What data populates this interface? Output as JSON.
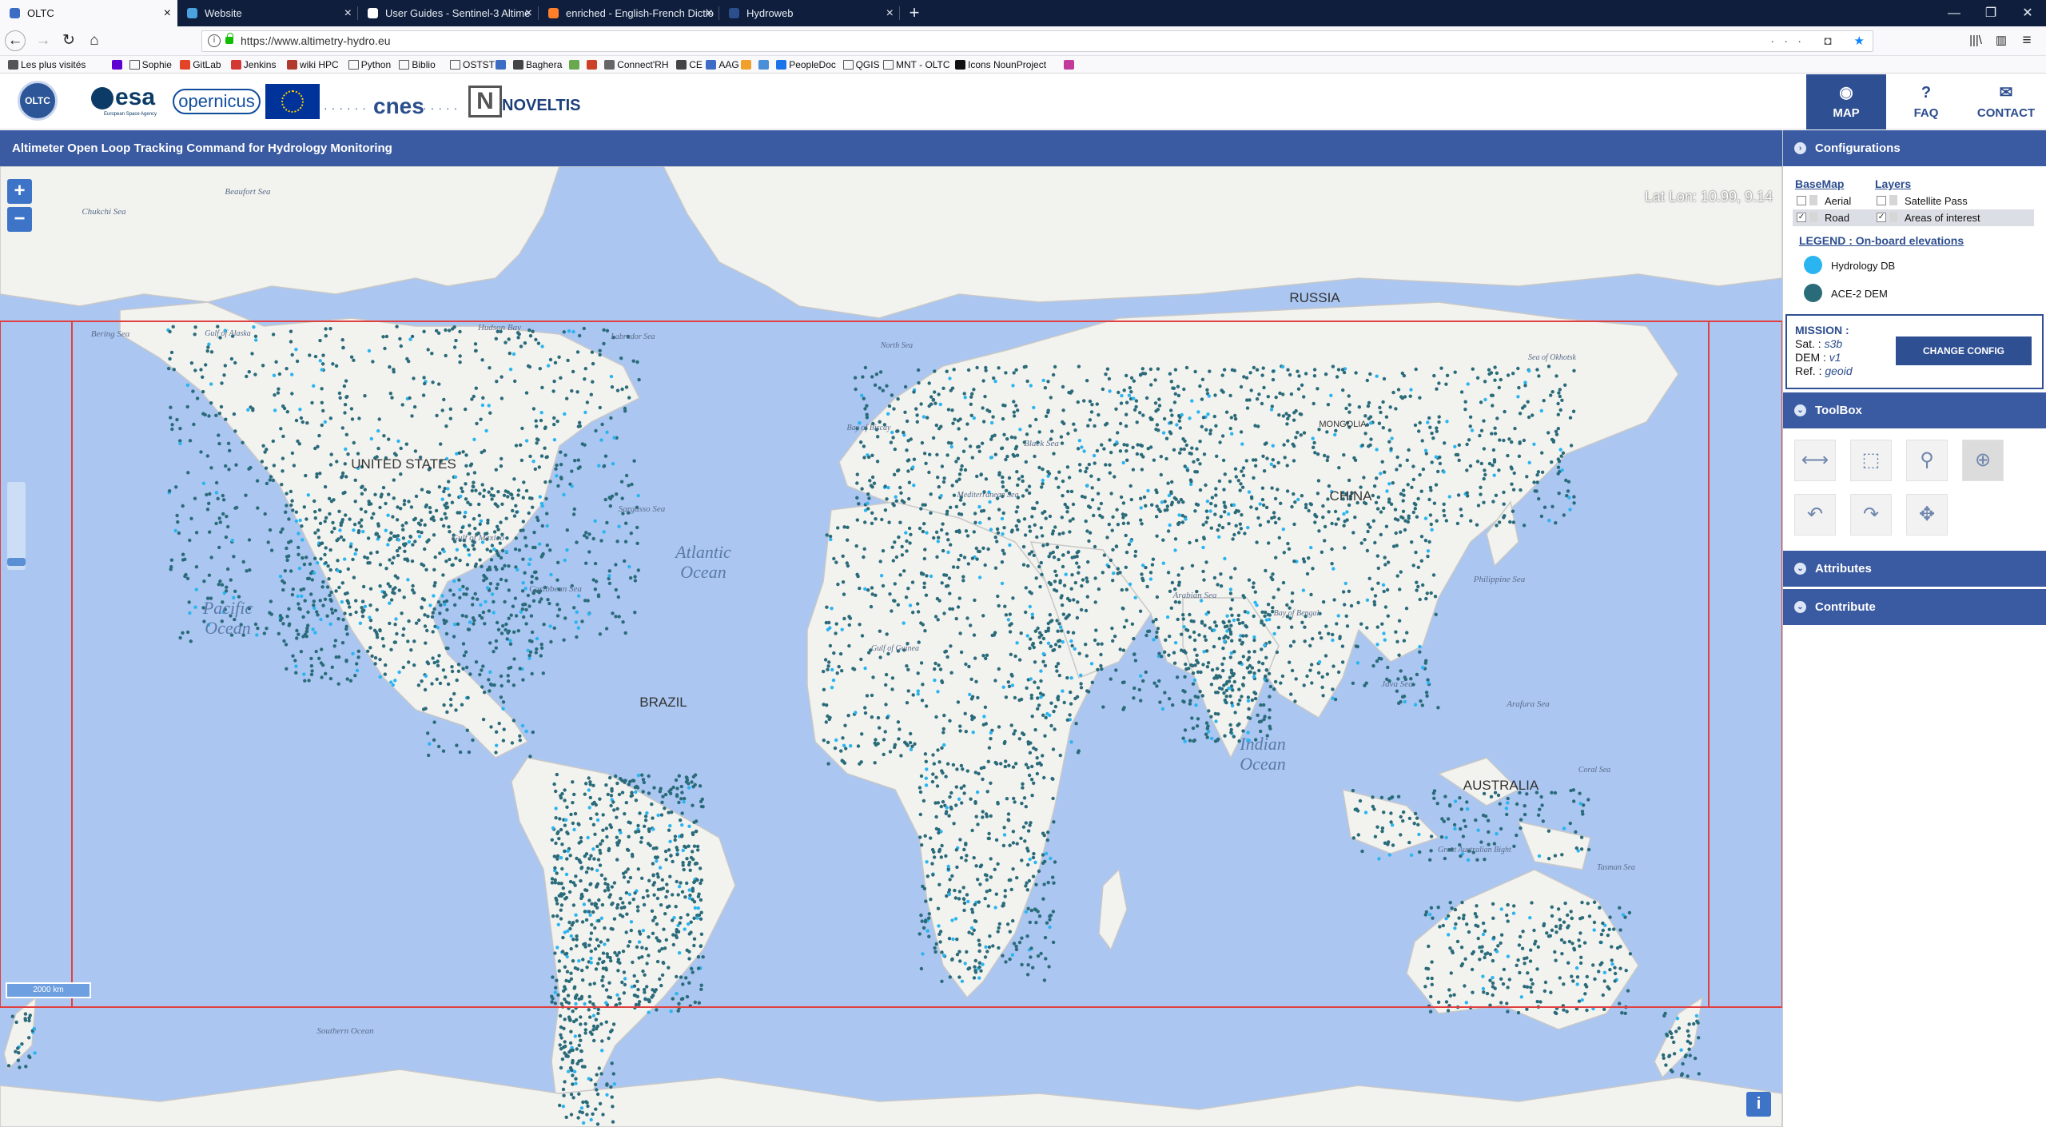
{
  "browser": {
    "tabs": [
      {
        "title": "OLTC",
        "active": true,
        "color": "#3c6cc4"
      },
      {
        "title": "Website",
        "active": false,
        "color": "#4aa3df"
      },
      {
        "title": "User Guides - Sentinel-3 Altime",
        "active": false,
        "color": "#ffffff"
      },
      {
        "title": "enriched - English-French Dictio",
        "active": false,
        "color": "#ff7f2a"
      },
      {
        "title": "Hydroweb",
        "active": false,
        "color": "#2b4f8c"
      }
    ],
    "new_tab_label": "+",
    "window_controls": [
      "—",
      "❐",
      "✕"
    ],
    "url": "https://www.altimetry-hydro.eu",
    "bookmarks": [
      {
        "label": "Les plus visités",
        "icon": "gear-icon",
        "color": "#555555"
      },
      {
        "label": "",
        "icon": "yahoo-icon",
        "color": "#5f01d1"
      },
      {
        "label": "Sophie",
        "icon": "folder-icon",
        "color": ""
      },
      {
        "label": "GitLab",
        "icon": "gitlab-icon",
        "color": "#e24329"
      },
      {
        "label": "Jenkins",
        "icon": "jenkins-icon",
        "color": "#d33833"
      },
      {
        "label": "wiki HPC",
        "icon": "wiki-icon",
        "color": "#b03a2e"
      },
      {
        "label": "Python",
        "icon": "folder-icon",
        "color": ""
      },
      {
        "label": "Biblio",
        "icon": "folder-icon",
        "color": ""
      },
      {
        "label": "OSTST",
        "icon": "folder-icon",
        "color": ""
      },
      {
        "label": "",
        "icon": "site-icon",
        "color": "#3c6cc4"
      },
      {
        "label": "Baghera",
        "icon": "baghera-icon",
        "color": "#444444"
      },
      {
        "label": "",
        "icon": "doc-icon",
        "color": "#6aa84f"
      },
      {
        "label": "",
        "icon": "site-icon",
        "color": "#cc4125"
      },
      {
        "label": "Connect'RH",
        "icon": "connect-icon",
        "color": "#666666"
      },
      {
        "label": "CE",
        "icon": "ce-icon",
        "color": "#444444"
      },
      {
        "label": "AAG",
        "icon": "aag-icon",
        "color": "#3c6cc4"
      },
      {
        "label": "",
        "icon": "rss-icon",
        "color": "#f1a02c"
      },
      {
        "label": "",
        "icon": "site-icon",
        "color": "#4a90d9"
      },
      {
        "label": "PeopleDoc",
        "icon": "peopledoc-icon",
        "color": "#1a73e8"
      },
      {
        "label": "QGIS",
        "icon": "folder-icon",
        "color": ""
      },
      {
        "label": "MNT - OLTC",
        "icon": "folder-icon",
        "color": ""
      },
      {
        "label": "Icons NounProject",
        "icon": "noun-icon",
        "color": "#111111"
      },
      {
        "label": "",
        "icon": "site-icon",
        "color": "#c23b9b"
      }
    ]
  },
  "header": {
    "logos": {
      "oltc": "OLTC",
      "esa": "esa",
      "esa_sub": "European Space Agency",
      "copernicus": "opernicus",
      "cnes": "cnes",
      "noveltis": "NOVELTIS"
    },
    "nav": [
      {
        "label": "MAP",
        "icon": "globe-icon",
        "active": true
      },
      {
        "label": "FAQ",
        "icon": "question-icon",
        "active": false
      },
      {
        "label": "CONTACT",
        "icon": "mail-icon",
        "active": false
      }
    ]
  },
  "title": "Altimeter Open Loop Tracking Command for Hydrology Monitoring",
  "map": {
    "zoom_in": "+",
    "zoom_out": "−",
    "latlon": "Lat Lon: 10.99, 9.14",
    "scale": "2000 km",
    "info": "i",
    "oceans": [
      {
        "label": "Pacific",
        "label2": "Ocean"
      },
      {
        "label": "Atlantic",
        "label2": "Ocean"
      },
      {
        "label": "Indian",
        "label2": "Ocean"
      }
    ],
    "countries": [
      "RUSSIA",
      "UNITED STATES",
      "CHINA",
      "BRAZIL",
      "AUSTRALIA",
      "MONGOLIA"
    ],
    "seas": [
      "Chukchi Sea",
      "Beaufort Sea",
      "Bering Sea",
      "Gulf of Alaska",
      "Hudson Bay",
      "Labrador Sea",
      "Sargasso Sea",
      "Gulf of Mexico",
      "Caribbean Sea",
      "Mediterranean Sea",
      "Black Sea",
      "North Sea",
      "Bay of Biscay",
      "Gulf of Guinea",
      "Arabian Sea",
      "Bay of Bengal",
      "Philippine Sea",
      "Sea of Okhotsk",
      "Java Sea",
      "Arafura Sea",
      "Coral Sea",
      "Tasman Sea",
      "Great Australian Bight",
      "Southern Ocean"
    ],
    "point_colors": {
      "hydrology": "#2ab5f0",
      "ace2": "#2a6b7a"
    }
  },
  "sidebar": {
    "configurations_label": "Configurations",
    "basemap_label": "BaseMap",
    "layers_label": "Layers",
    "basemap_options": [
      {
        "label": "Aerial",
        "checked": false
      },
      {
        "label": "Road",
        "checked": true
      }
    ],
    "layer_options": [
      {
        "label": "Satellite Pass",
        "checked": false
      },
      {
        "label": "Areas of interest",
        "checked": true
      }
    ],
    "legend_title": "LEGEND : On-board elevations",
    "legend": [
      {
        "label": "Hydrology DB",
        "color": "#2ab5f0"
      },
      {
        "label": "ACE-2 DEM",
        "color": "#2a6b7a"
      }
    ],
    "mission": {
      "title": "MISSION :",
      "sat_label": "Sat. :",
      "sat_value": "s3b",
      "dem_label": "DEM :",
      "dem_value": "v1",
      "ref_label": "Ref. :",
      "ref_value": "geoid",
      "change_label": "CHANGE CONFIG"
    },
    "toolbox_label": "ToolBox",
    "tools": [
      {
        "icon": "pan-horizontal-icon",
        "glyph": "⟷",
        "active": false
      },
      {
        "icon": "bbox-select-icon",
        "glyph": "⬚",
        "active": false
      },
      {
        "icon": "zoom-icon",
        "glyph": "⚲",
        "active": false
      },
      {
        "icon": "zoom-in-icon",
        "glyph": "⊕",
        "active": true
      },
      {
        "icon": "undo-icon",
        "glyph": "↶",
        "active": false
      },
      {
        "icon": "redo-icon",
        "glyph": "↷",
        "active": false
      },
      {
        "icon": "center-icon",
        "glyph": "✥",
        "active": false
      }
    ],
    "attributes_label": "Attributes",
    "contribute_label": "Contribute"
  }
}
